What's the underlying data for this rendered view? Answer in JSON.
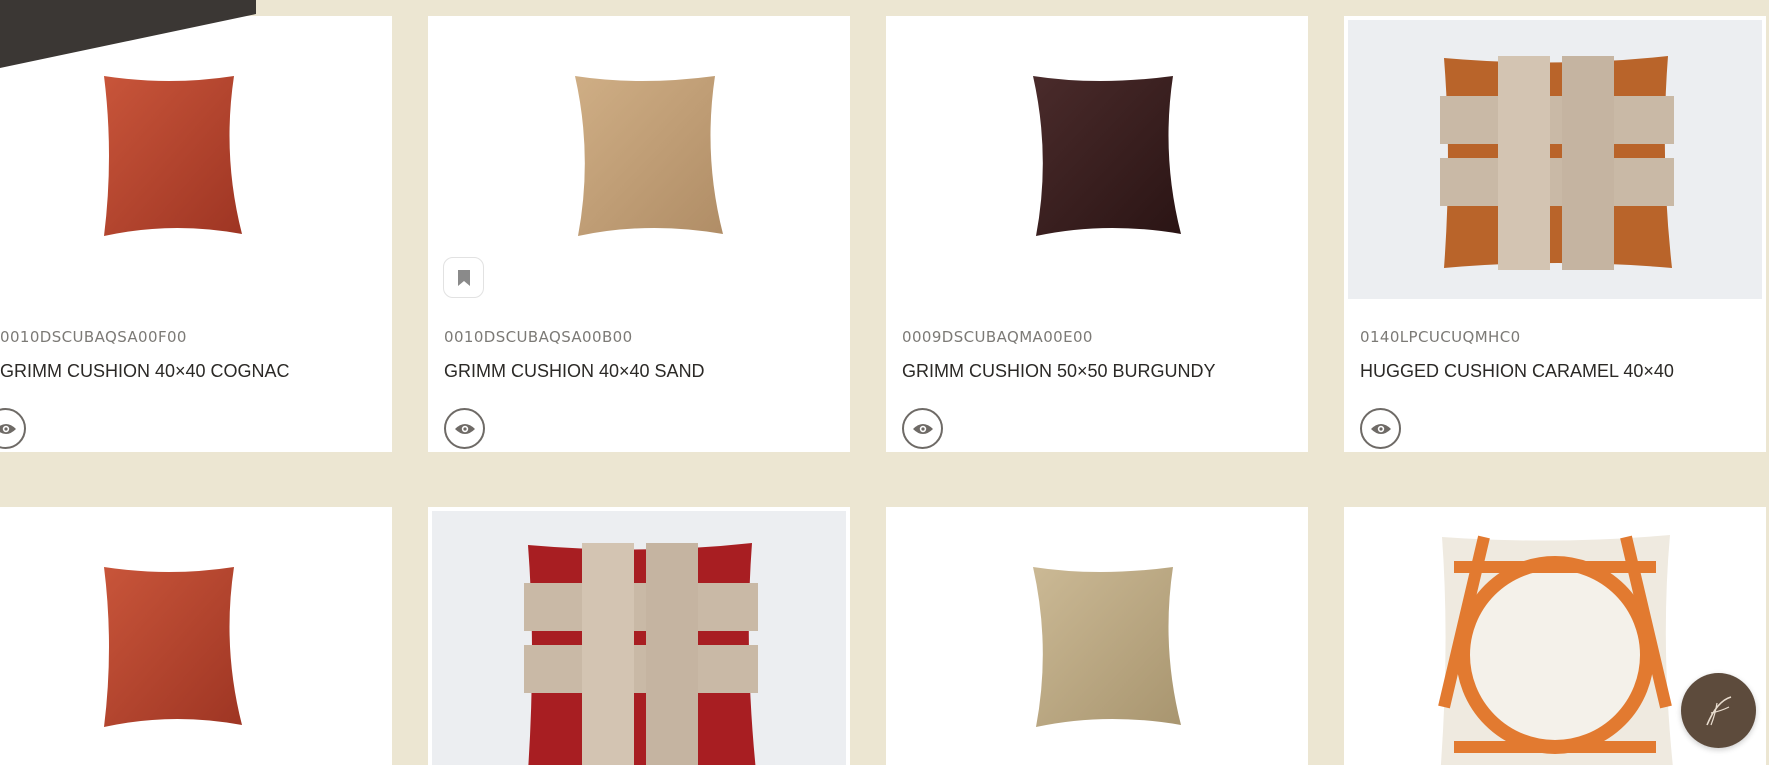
{
  "products": [
    {
      "sku": "0010DSCUBAQSA00F00",
      "title": "GRIMM CUSHION 40×40 COGNAC",
      "color": "#b8452c",
      "icon": "cushion-cognac"
    },
    {
      "sku": "0010DSCUBAQSA00B00",
      "title": "GRIMM CUSHION 40×40 SAND",
      "color": "#c5a57c",
      "icon": "cushion-sand"
    },
    {
      "sku": "0009DSCUBAQMA00E00",
      "title": "GRIMM CUSHION 50×50 BURGUNDY",
      "color": "#3a1f1f",
      "icon": "cushion-burgundy"
    },
    {
      "sku": "0140LPCUCUQMHC0",
      "title": "HUGGED CUSHION CARAMEL 40×40",
      "color": "#b9642a",
      "icon": "woven-cushion-caramel"
    },
    {
      "color": "#b8452c",
      "icon": "cushion-cognac"
    },
    {
      "color": "#a81e22",
      "icon": "woven-cushion-red"
    },
    {
      "color": "#c4b28d",
      "icon": "cushion-beige"
    },
    {
      "color": "#e27a30",
      "icon": "strap-cushion-orange"
    }
  ],
  "icons": {
    "view": "eye-icon",
    "bookmark": "bookmark-icon",
    "chat": "chat-logo-icon"
  },
  "colors": {
    "page_background": "#ece6d2",
    "card_background": "#ffffff",
    "banner": "#3b3734",
    "chat_button": "#5d4b3c"
  }
}
